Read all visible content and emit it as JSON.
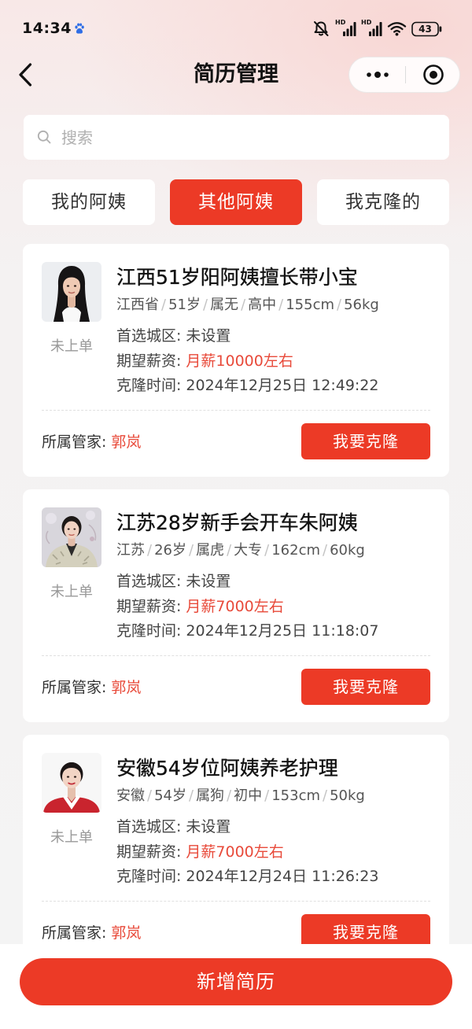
{
  "status_bar": {
    "time": "14:34",
    "network_badges": [
      "HD",
      "HD"
    ],
    "battery_level": "43",
    "icons": [
      "paw-icon",
      "mute-icon",
      "signal-icon",
      "signal-icon",
      "wifi-icon",
      "battery-icon"
    ]
  },
  "header": {
    "title": "简历管理",
    "icons": {
      "back": "chevron-left-icon",
      "more": "more-dots-icon",
      "exit": "target-circle-icon"
    }
  },
  "search": {
    "placeholder": "搜索",
    "value": "",
    "icon": "search-icon"
  },
  "tabs": [
    {
      "label": "我的阿姨",
      "active": false
    },
    {
      "label": "其他阿姨",
      "active": true
    },
    {
      "label": "我克隆的",
      "active": false
    }
  ],
  "attribute_separator": "/",
  "resumes": [
    {
      "status": "未上单",
      "title": "江西51岁阳阿姨擅长带小宝",
      "attributes": [
        "江西省",
        "51岁",
        "属无",
        "高中",
        "155cm",
        "56kg"
      ],
      "city_label": "首选城区:",
      "city_value": "未设置",
      "salary_label": "期望薪资:",
      "salary_value": "月薪10000左右",
      "clone_time_label": "克隆时间:",
      "clone_time_value": "2024年12月25日 12:49:22",
      "manager_label": "所属管家:",
      "manager_name": "郭岚",
      "action_label": "我要克隆"
    },
    {
      "status": "未上单",
      "title": "江苏28岁新手会开车朱阿姨",
      "attributes": [
        "江苏",
        "26岁",
        "属虎",
        "大专",
        "162cm",
        "60kg"
      ],
      "city_label": "首选城区:",
      "city_value": "未设置",
      "salary_label": "期望薪资:",
      "salary_value": "月薪7000左右",
      "clone_time_label": "克隆时间:",
      "clone_time_value": "2024年12月25日 11:18:07",
      "manager_label": "所属管家:",
      "manager_name": "郭岚",
      "action_label": "我要克隆"
    },
    {
      "status": "未上单",
      "title": "安徽54岁位阿姨养老护理",
      "attributes": [
        "安徽",
        "54岁",
        "属狗",
        "初中",
        "153cm",
        "50kg"
      ],
      "city_label": "首选城区:",
      "city_value": "未设置",
      "salary_label": "期望薪资:",
      "salary_value": "月薪7000左右",
      "clone_time_label": "克隆时间:",
      "clone_time_value": "2024年12月24日 11:26:23",
      "manager_label": "所属管家:",
      "manager_name": "郭岚",
      "action_label": "我要克隆"
    }
  ],
  "bottom_action": {
    "label": "新增简历"
  },
  "colors": {
    "accent": "#ec3a26",
    "highlight_text": "#e84a3a",
    "muted_text": "#999999",
    "page_background": "#f4f4f4"
  }
}
